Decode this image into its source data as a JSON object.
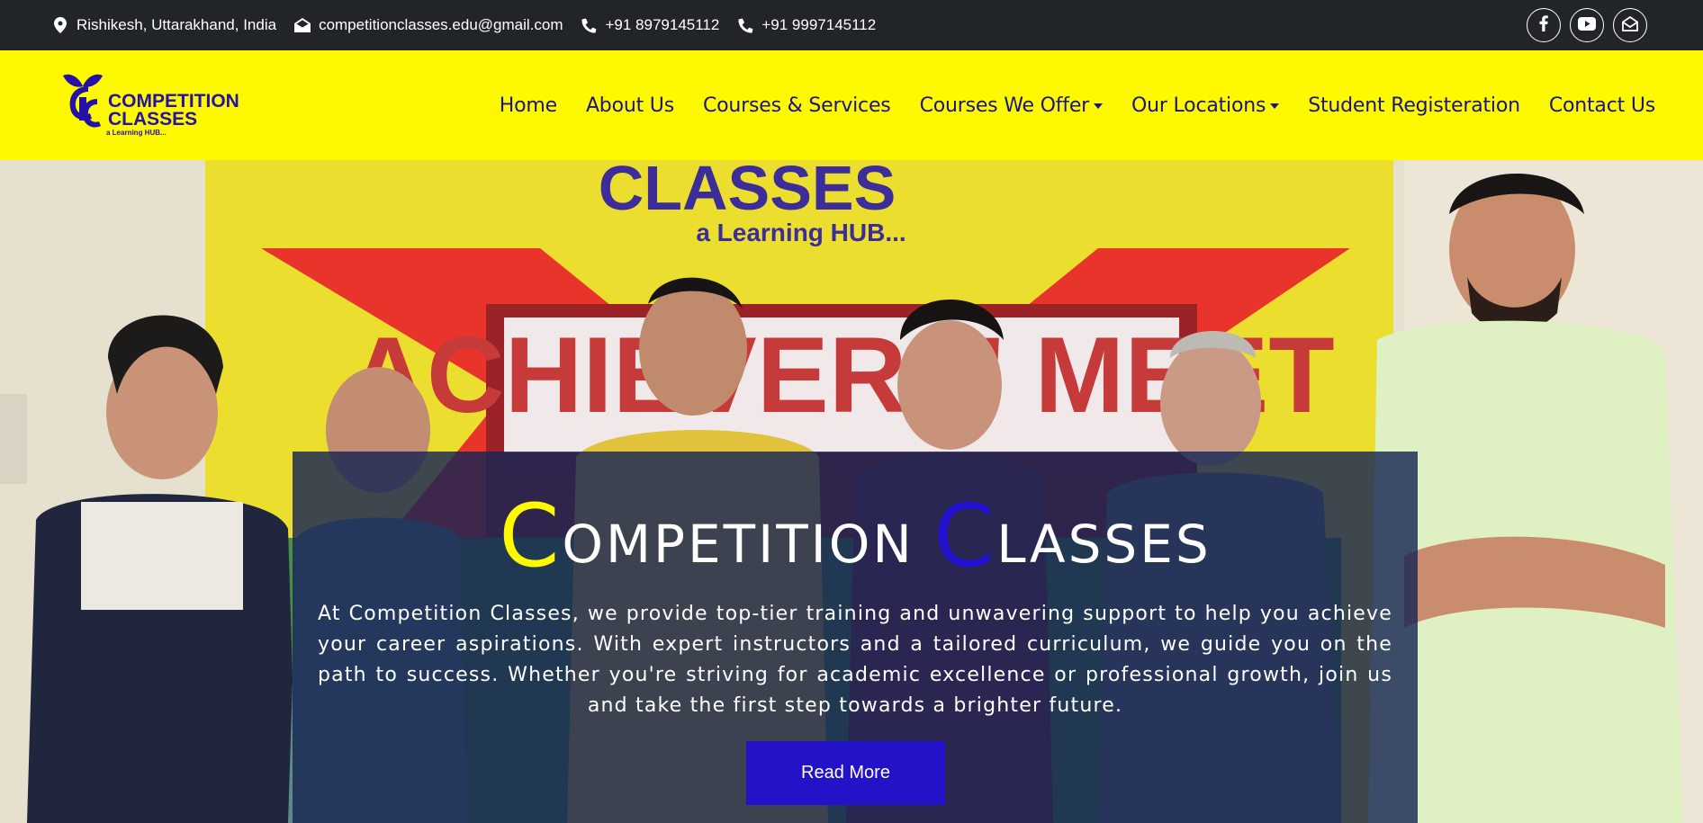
{
  "topbar": {
    "location": "Rishikesh, Uttarakhand, India",
    "email": "competitionclasses.edu@gmail.com",
    "phone1": "+91 8979145112",
    "phone2": "+91 9997145112",
    "social": [
      {
        "icon": "facebook-icon"
      },
      {
        "icon": "youtube-icon"
      },
      {
        "icon": "envelope-open-icon"
      }
    ]
  },
  "logo": {
    "line1": "COMPETITION",
    "line2": "CLASSES",
    "tagline": "a Learning HUB..."
  },
  "nav": {
    "items": [
      {
        "label": "Home"
      },
      {
        "label": "About Us"
      },
      {
        "label": "Courses & Services"
      },
      {
        "label": "Courses We Offer",
        "dropdown": true
      },
      {
        "label": "Our Locations",
        "dropdown": true
      },
      {
        "label": "Student Registeration"
      },
      {
        "label": "Contact Us"
      }
    ]
  },
  "hero": {
    "title_first_initial": "C",
    "title_first_rest": "ompetition",
    "title_second_initial": "C",
    "title_second_rest": "lasses",
    "description": "At Competition Classes, we provide top-tier training and unwavering support to help you achieve your career aspirations. With expert instructors and a tailored curriculum, we guide you on the path to success. Whether you're striving for academic excellence or professional growth, join us and take the first step towards a brighter future.",
    "button_label": "Read More",
    "banner_text_top": "CLASSES",
    "banner_text_sub": "a Learning HUB...",
    "banner_text_main": "ACHIEVERS' MEET"
  },
  "colors": {
    "topbar_bg": "#212529",
    "nav_bg": "#fff900",
    "nav_text": "#1a1485",
    "accent_yellow": "#fff900",
    "accent_blue": "#2412d1",
    "button_bg": "#2412c9"
  }
}
